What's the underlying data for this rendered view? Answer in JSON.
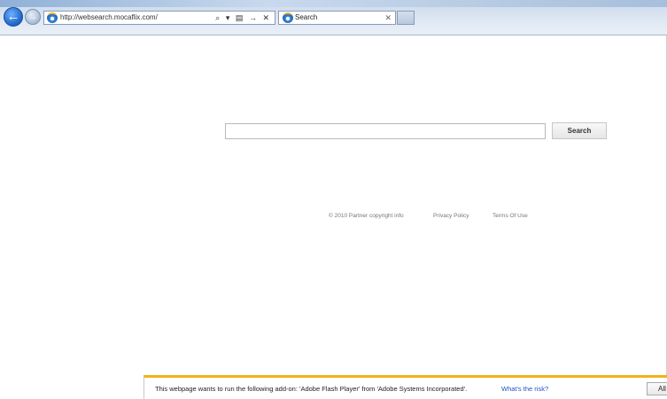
{
  "browser": {
    "url": "http://websearch.mocaflix.com/",
    "tab_title": "Search",
    "addr_tools": {
      "search": "⌕",
      "dropdown": "▾",
      "compat": "▤",
      "go": "→",
      "stop": "✕"
    },
    "tab_close": "✕",
    "back_glyph": "←",
    "forward_glyph": "→"
  },
  "page": {
    "search": {
      "value": "",
      "placeholder": "",
      "button_label": "Search"
    },
    "footer": {
      "copyright": "© 2010 Partner copyright info",
      "privacy": "Privacy Policy",
      "terms": "Terms Of Use"
    }
  },
  "notification": {
    "message": "This webpage wants to run the following add-on: 'Adobe Flash Player' from 'Adobe Systems Incorporated'.",
    "link": "What's the risk?",
    "allow_label": "All"
  },
  "colors": {
    "notification_accent": "#f1b416",
    "link": "#1a55c5",
    "back_button": "#1d63c6"
  }
}
